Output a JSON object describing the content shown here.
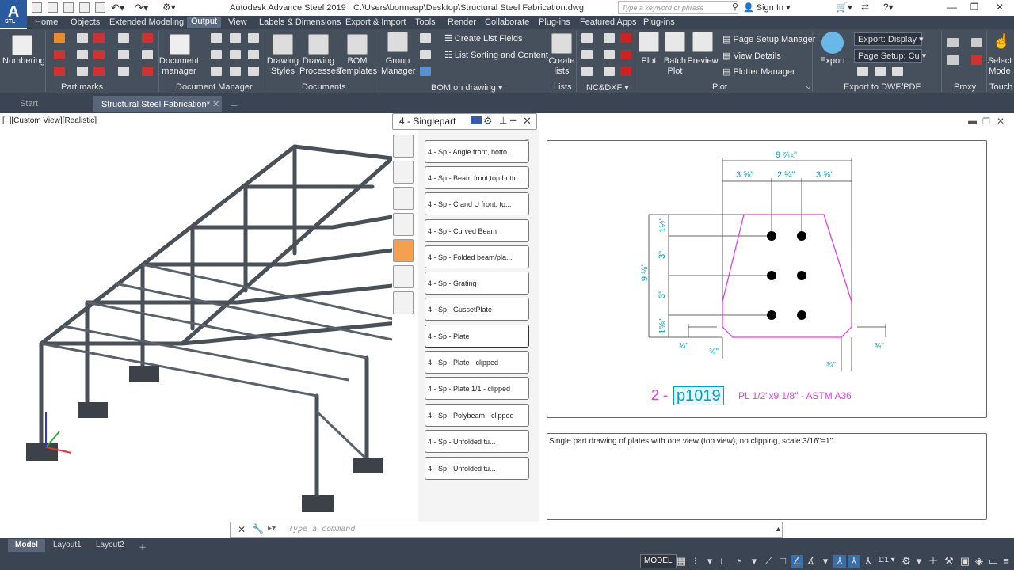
{
  "app": {
    "logo": "A",
    "logo_sub": "STL",
    "title": "Autodesk Advance Steel 2019",
    "path": "C:\\Users\\bonneap\\Desktop\\Structural Steel Fabrication.dwg"
  },
  "search": {
    "placeholder": "Type a keyword or phrase"
  },
  "account": {
    "signin": "Sign In"
  },
  "menu": [
    "Home",
    "Objects",
    "Extended Modeling",
    "Output",
    "View",
    "Labels & Dimensions",
    "Export & Import",
    "Tools",
    "Render",
    "Collaborate",
    "Plug-ins",
    "Featured Apps",
    "Plug-ins"
  ],
  "ribbon": {
    "numbering": "Numbering",
    "doc_manager": "Document\nmanager",
    "drawing_styles": "Drawing\nStyles",
    "drawing_processes": "Drawing\nProcesses",
    "bom_templates": "BOM\nTemplates",
    "group_manager": "Group\nManager",
    "create_list_fields": "Create List Fields",
    "list_sorting": "List Sorting and Content",
    "create_lists": "Create\nlists",
    "plot": "Plot",
    "batch_plot": "Batch\nPlot",
    "preview": "Preview",
    "page_setup_manager": "Page Setup Manager",
    "view_details": "View Details",
    "plotter_manager": "Plotter Manager",
    "export": "Export",
    "export_display": "Export: Display",
    "page_setup": "Page Setup: Cu",
    "select_mode": "Select\nMode",
    "panels": {
      "part_marks": "Part marks",
      "document_manager": "Document Manager",
      "documents": "Documents",
      "bom_on_drawing": "BOM on drawing",
      "lists": "Lists",
      "nc_dxf": "NC&DXF",
      "plot": "Plot",
      "export_dwf": "Export to DWF/PDF",
      "proxy": "Proxy",
      "touch": "Touch"
    }
  },
  "file_tabs": {
    "start": "Start",
    "active": "Structural Steel Fabrication*"
  },
  "viewport": {
    "label": "[−][Custom View][Realistic]"
  },
  "dialog": {
    "title": "4 - Singlepart",
    "items": [
      "4 - Sp - Angle front, botto...",
      "4 - Sp - Beam front,top,botto...",
      "4 - Sp - C and U front, to...",
      "4 - Sp - Curved Beam",
      "4 - Sp - Folded beam/pla...",
      "4 - Sp - Grating",
      "4 - Sp - GussetPlate",
      "4 - Sp - Plate",
      "4 - Sp - Plate - clipped",
      "4 - Sp - Plate 1/1 - clipped",
      "4 - Sp - Polybeam - clipped",
      "4 - Sp - Unfolded tu...",
      "4 - Sp - Unfolded tu..."
    ],
    "description": "Single part drawing of plates with one view (top view), no clipping, scale 3/16\"=1\"."
  },
  "drawing": {
    "dims": {
      "overall_width": "9 ⁷⁄₁₆\"",
      "w1": "3 ⅝\"",
      "w2": "2 ¼\"",
      "w3": "3 ⅝\"",
      "overall_height": "9 ⅛\"",
      "h1": "1½\"",
      "h2": "3\"",
      "h3": "3\"",
      "h4": "1⅝\"",
      "e1": "¾\"",
      "e2": "¾\"",
      "e3": "¾\"",
      "e4": "¾\""
    },
    "qty": "2 -",
    "mark": "p1019",
    "spec": "PL 1/2\"x9 1/8\" - ASTM A36"
  },
  "command": {
    "placeholder": "Type a command"
  },
  "layout_tabs": [
    "Model",
    "Layout1",
    "Layout2"
  ],
  "status": {
    "model": "MODEL",
    "scale": "1:1"
  },
  "colors": {
    "ribbon": "#464f5c",
    "menubar": "#3b4453",
    "plate": "#e040e0",
    "dim": "#00a0c0"
  }
}
